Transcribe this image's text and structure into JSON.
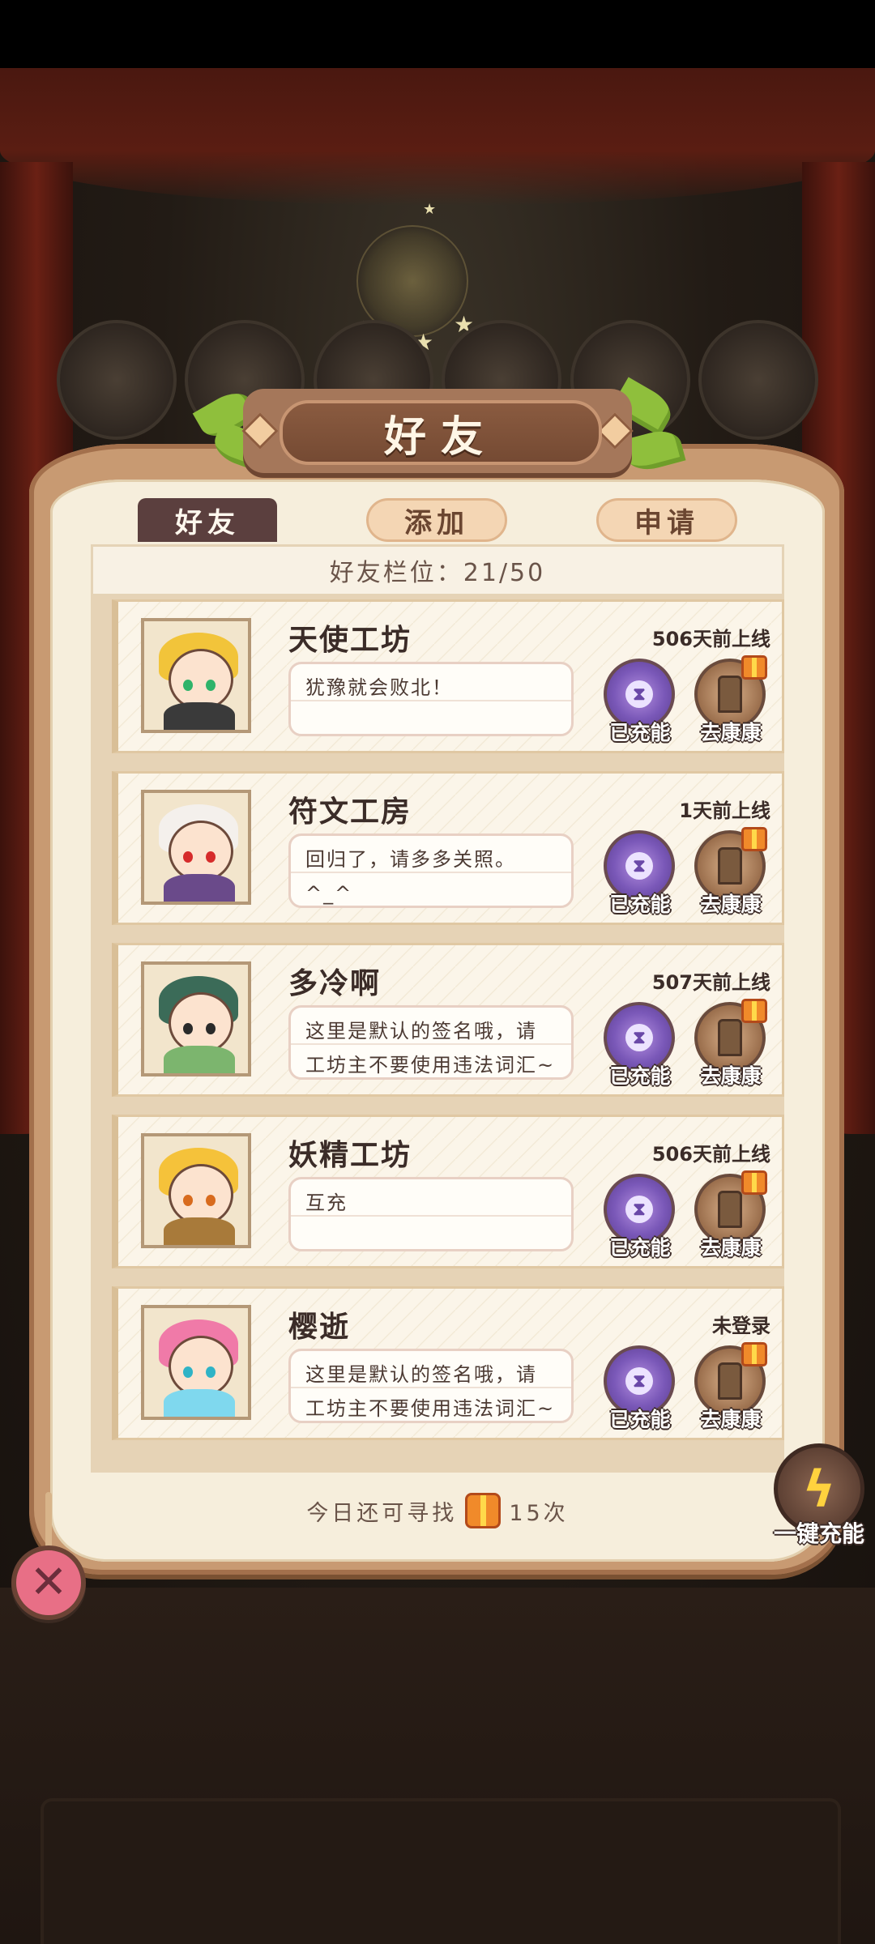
{
  "dialog": {
    "title": "好友"
  },
  "tabs": [
    {
      "label": "好友",
      "active": true
    },
    {
      "label": "添加",
      "active": false
    },
    {
      "label": "申请",
      "active": false
    }
  ],
  "slots": {
    "text": "好友栏位：21/50"
  },
  "friends": [
    {
      "name": "天使工坊",
      "last_online": "506天前上线",
      "signature": "犹豫就会败北！",
      "charge_label": "已充能",
      "visit_label": "去康康",
      "hair_color": "#f2c43a",
      "body_color": "#3a3a3a",
      "eye_color": "#2fb36a"
    },
    {
      "name": "符文工房",
      "last_online": "1天前上线",
      "signature": "回归了，请多多关照。^_^",
      "charge_label": "已充能",
      "visit_label": "去康康",
      "hair_color": "#f4f0ec",
      "body_color": "#6a4a8a",
      "eye_color": "#d62b2b"
    },
    {
      "name": "多冷啊",
      "last_online": "507天前上线",
      "signature": "这里是默认的签名哦，请工坊主不要使用违法词汇~",
      "charge_label": "已充能",
      "visit_label": "去康康",
      "hair_color": "#3b6b58",
      "body_color": "#7cb56e",
      "eye_color": "#2a2a2a"
    },
    {
      "name": "妖精工坊",
      "last_online": "506天前上线",
      "signature": "互充",
      "charge_label": "已充能",
      "visit_label": "去康康",
      "hair_color": "#f5c23a",
      "body_color": "#a87a3a",
      "eye_color": "#d86b1e"
    },
    {
      "name": "樱逝",
      "last_online": "未登录",
      "signature": "这里是默认的签名哦，请工坊主不要使用违法词汇~",
      "charge_label": "已充能",
      "visit_label": "去康康",
      "hair_color": "#f07aa8",
      "body_color": "#7fd8ee",
      "eye_color": "#2fb3c6"
    }
  ],
  "footer": {
    "prefix": "今日还可寻找",
    "count": "15次"
  },
  "charge_all": {
    "label": "一键充能"
  },
  "icons": {
    "charge": "hourglass-icon",
    "visit": "door-icon",
    "gift": "gift-icon",
    "charge_all": "lightning-icon",
    "close": "close-icon"
  }
}
